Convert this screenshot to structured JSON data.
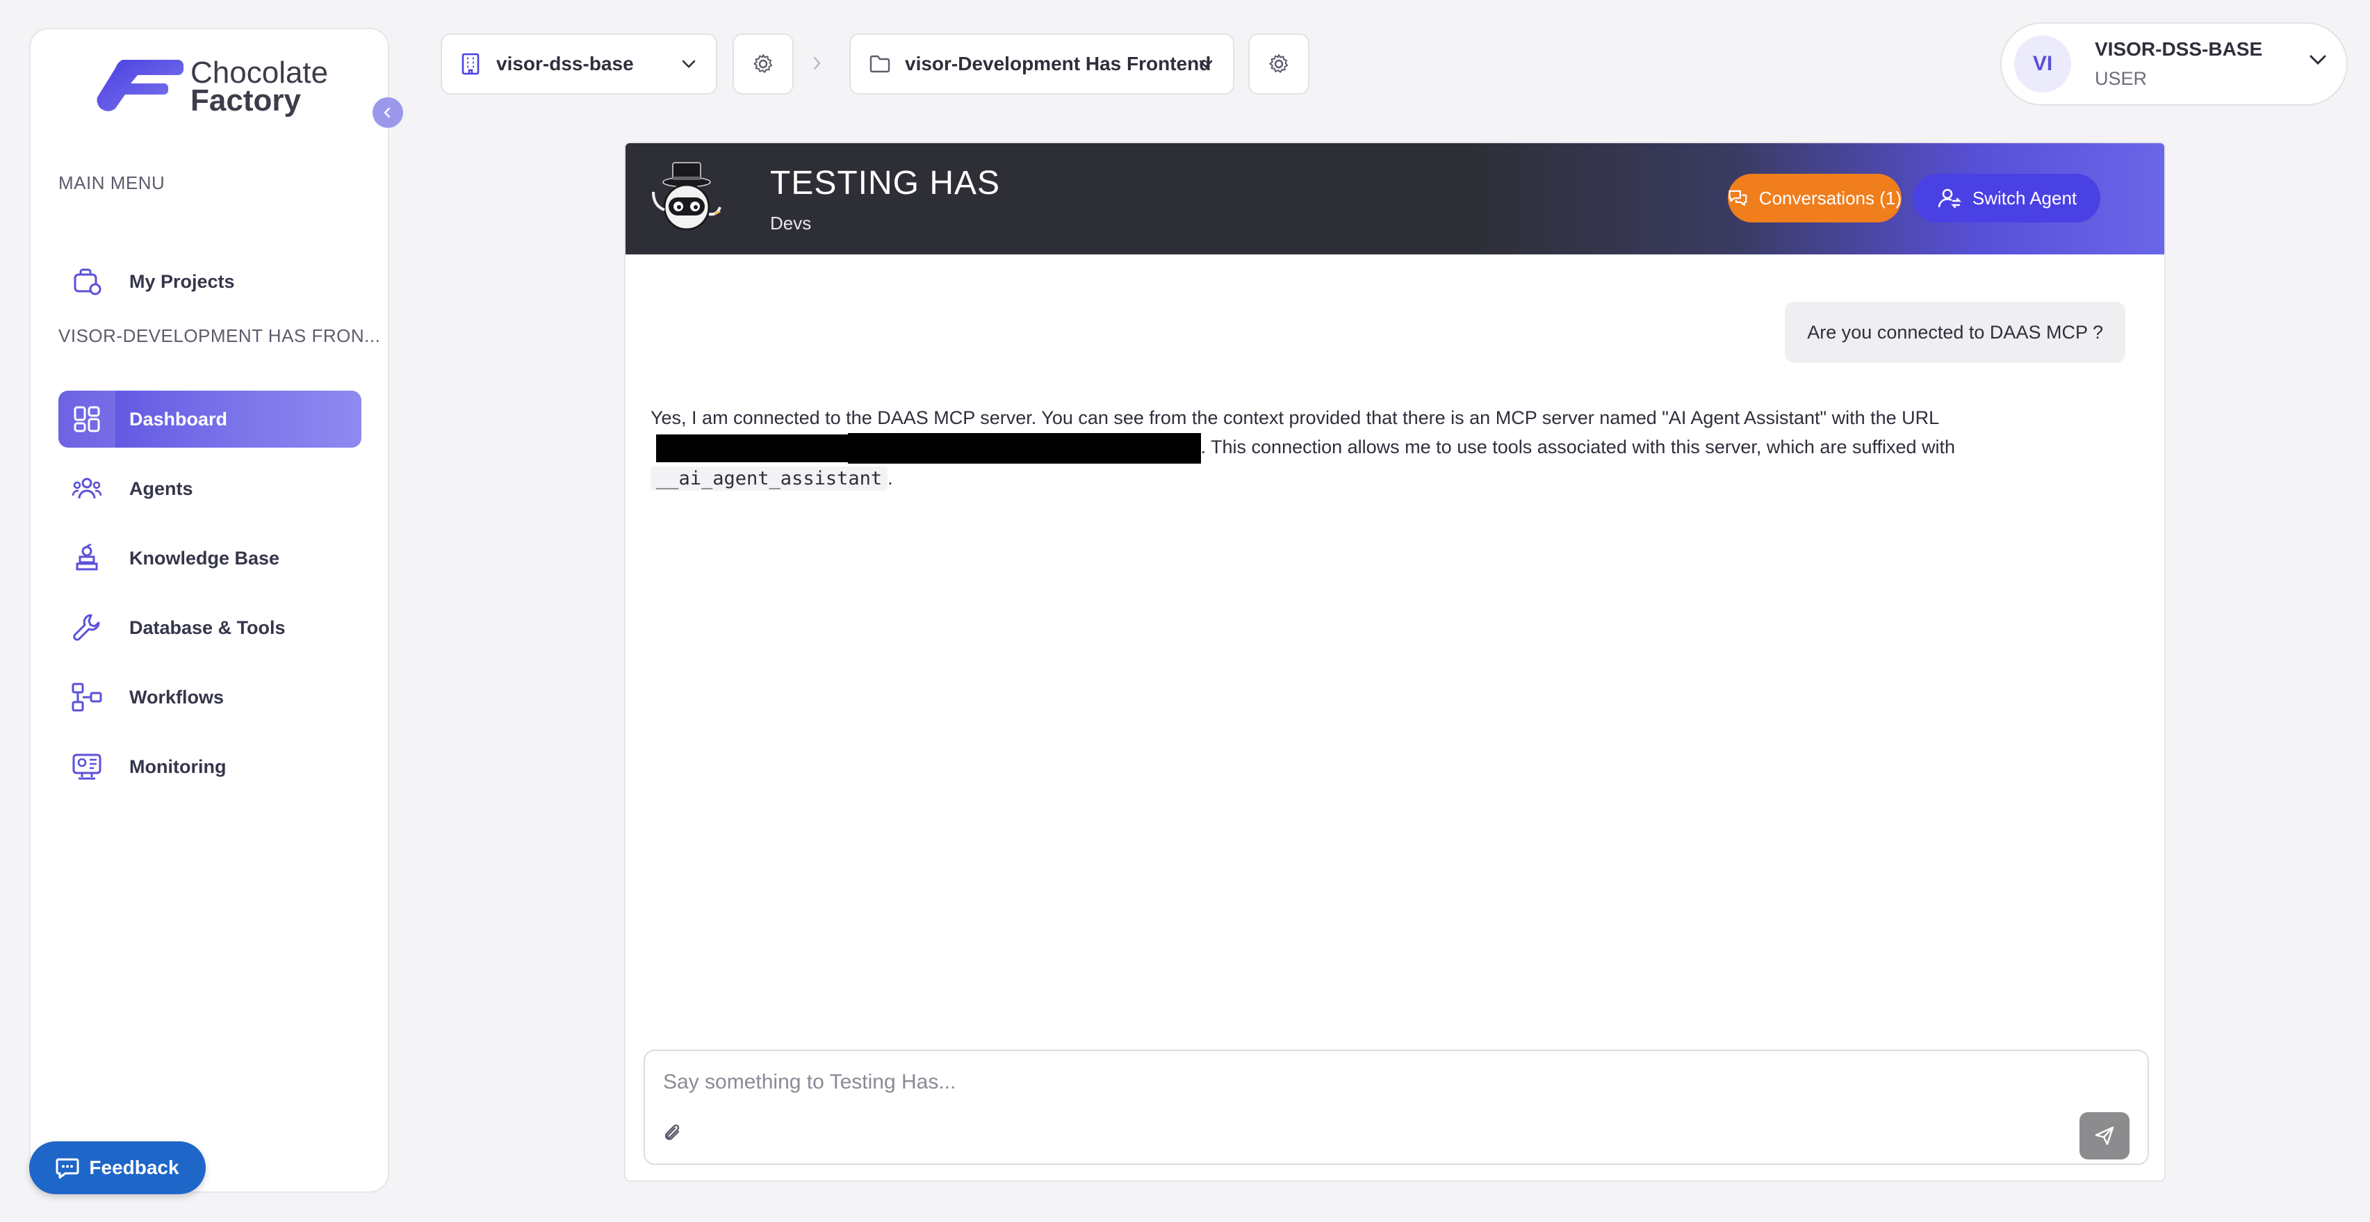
{
  "brand": {
    "name_line1": "Chocolate",
    "name_line2": "Factory"
  },
  "sidebar": {
    "main_menu_title": "MAIN MENU",
    "my_projects_label": "My Projects",
    "project_section_title": "VISOR-DEVELOPMENT HAS FRON...",
    "items": [
      {
        "label": "Dashboard",
        "icon": "dashboard-icon",
        "active": true
      },
      {
        "label": "Agents",
        "icon": "agents-icon"
      },
      {
        "label": "Knowledge Base",
        "icon": "knowledge-base-icon"
      },
      {
        "label": "Database & Tools",
        "icon": "wrench-icon"
      },
      {
        "label": "Workflows",
        "icon": "workflows-icon"
      },
      {
        "label": "Monitoring",
        "icon": "monitoring-icon"
      }
    ],
    "feedback_label": "Feedback"
  },
  "topbar": {
    "organization": "visor-dss-base",
    "project": "visor-Development Has Frontend"
  },
  "user": {
    "initials": "VI",
    "name": "VISOR-DSS-BASE",
    "role": "USER"
  },
  "chat": {
    "agent_name": "TESTING HAS",
    "agent_team": "Devs",
    "conversations_label": "Conversations (1)",
    "switch_agent_label": "Switch Agent",
    "user_message": "Are you connected to DAAS MCP ?",
    "bot_message": {
      "part1": "Yes, I am connected to the DAAS MCP server. You can see from the context provided that there is an MCP server named \"AI Agent Assistant\" with the URL",
      "part2": ". This connection allows me to use tools associated with this server, which are suffixed with",
      "code": "__ai_agent_assistant",
      "part3": "."
    },
    "input_placeholder": "Say something to Testing Has..."
  },
  "colors": {
    "accent": "#5a4de0",
    "conversations_button": "#f07e1d",
    "switch_agent_button": "#4a41e4",
    "header_dark": "#2e2f36",
    "feedback_button": "#1f66c9"
  }
}
